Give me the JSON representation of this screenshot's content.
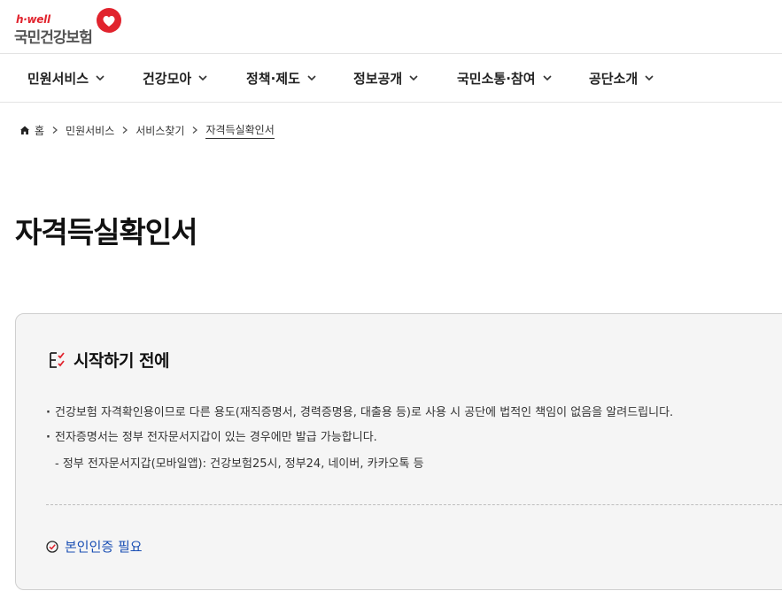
{
  "logo": {
    "brand_en": "h·well",
    "brand_ko": "국민건강보험"
  },
  "gnb": {
    "items": [
      {
        "label": "민원서비스"
      },
      {
        "label": "건강모아"
      },
      {
        "label": "정책·제도"
      },
      {
        "label": "정보공개"
      },
      {
        "label": "국민소통·참여"
      },
      {
        "label": "공단소개"
      }
    ]
  },
  "breadcrumb": {
    "items": [
      "홈",
      "민원서비스",
      "서비스찾기",
      "자격득실확인서"
    ]
  },
  "page": {
    "title": "자격득실확인서"
  },
  "notice": {
    "heading": "시작하기 전에",
    "items": [
      "건강보험 자격확인용이므로 다른 용도(재직증명서, 경력증명용, 대출용 등)로 사용 시 공단에 법적인 책임이 없음을 알려드립니다.",
      "전자증명서는 정부 전자문서지갑이 있는 경우에만 발급 가능합니다."
    ],
    "sub_item": "- 정부 전자문서지갑(모바일앱): 건강보험25시, 정부24, 네이버, 카카오톡 등",
    "auth_required": "본인인증 필요"
  },
  "colors": {
    "brand_red": "#e1232d",
    "link_blue": "#1a4fb4",
    "box_bg": "#f5f5f5"
  },
  "icons": [
    "heart-logo-icon",
    "chevron-down-icon",
    "home-icon",
    "chevron-right-icon",
    "checklist-icon",
    "check-circle-icon"
  ]
}
